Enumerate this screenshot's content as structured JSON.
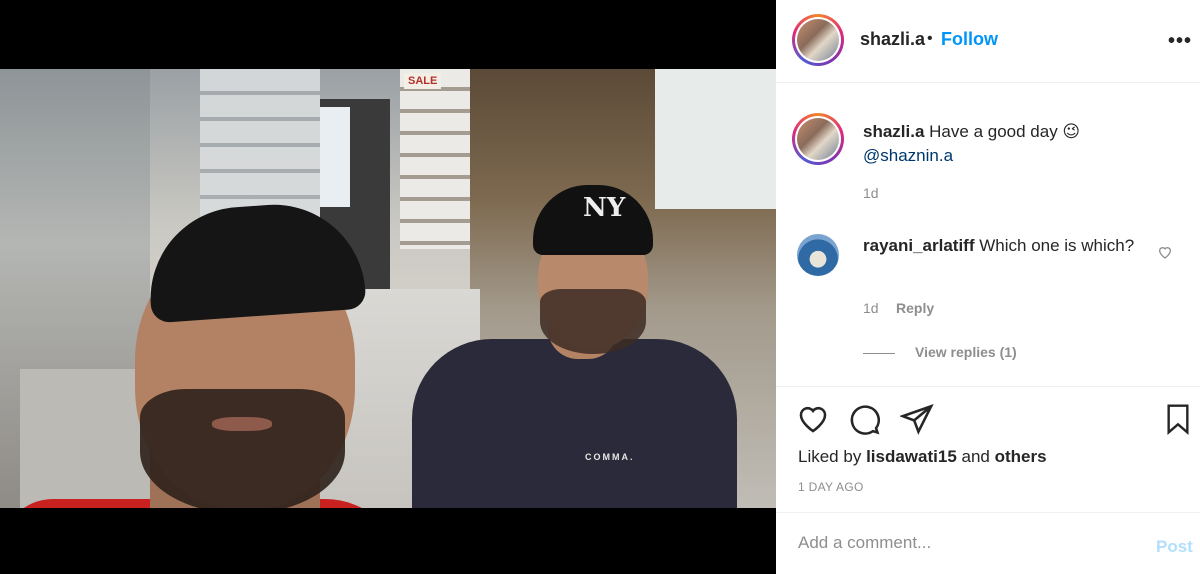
{
  "post": {
    "image_alt": "Two men in a bathroom fittings shop",
    "sign_sale": "SALE",
    "cap_logo": "NY",
    "shirt_logo": "COMMA."
  },
  "header": {
    "username": "shazli.a",
    "separator": "•",
    "follow_label": "Follow",
    "more_icon": "more-horizontal-icon",
    "more_label": "•••"
  },
  "caption": {
    "username": "shazli.a",
    "text": "Have a good day 😉",
    "mention": "@shaznin.a",
    "time": "1d"
  },
  "comments": [
    {
      "username": "rayani_arlatiff",
      "text": "Which one is which?",
      "time": "1d",
      "reply_label": "Reply",
      "like_icon": "heart-outline-icon"
    }
  ],
  "view_replies_label": "View replies (1)",
  "actions": {
    "icons": [
      "heart-icon",
      "comment-icon",
      "share-icon",
      "bookmark-icon"
    ]
  },
  "likes": {
    "prefix": "Liked by",
    "user": "lisdawati15",
    "joiner": "and",
    "others": "others"
  },
  "posted_ago": "1 DAY AGO",
  "add_comment": {
    "placeholder": "Add a comment...",
    "post_label": "Post"
  },
  "colors": {
    "link_blue": "#0095f6",
    "mention_blue": "#00376b",
    "muted": "#8e8e8e",
    "post_disabled": "#b2dffc"
  }
}
